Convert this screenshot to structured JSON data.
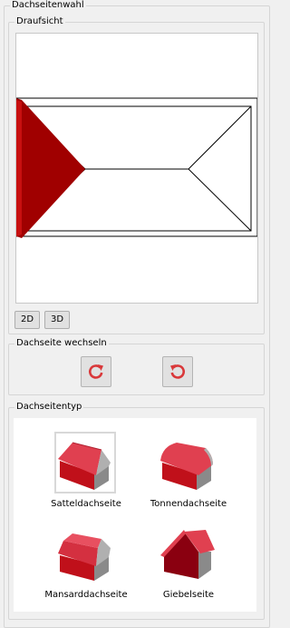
{
  "panel": {
    "title": "Dachseitenwahl"
  },
  "top_view": {
    "title": "Draufsicht",
    "view_buttons": [
      {
        "label": "2D"
      },
      {
        "label": "3D"
      }
    ],
    "selected_face_color": "#c00000"
  },
  "switch_side": {
    "title": "Dachseite wechseln",
    "buttons": [
      {
        "icon": "rotate-clockwise-icon"
      },
      {
        "icon": "rotate-counterclockwise-icon"
      }
    ],
    "icon_color": "#d9383a"
  },
  "roof_types": {
    "title": "Dachseitentyp",
    "selected": "Satteldachseite",
    "items": [
      {
        "label": "Satteldachseite"
      },
      {
        "label": "Tonnendachseite"
      },
      {
        "label": "Mansarddachseite"
      },
      {
        "label": "Giebelseite"
      }
    ],
    "roof_color": "#e04050",
    "wall_color": "#c0101a"
  }
}
